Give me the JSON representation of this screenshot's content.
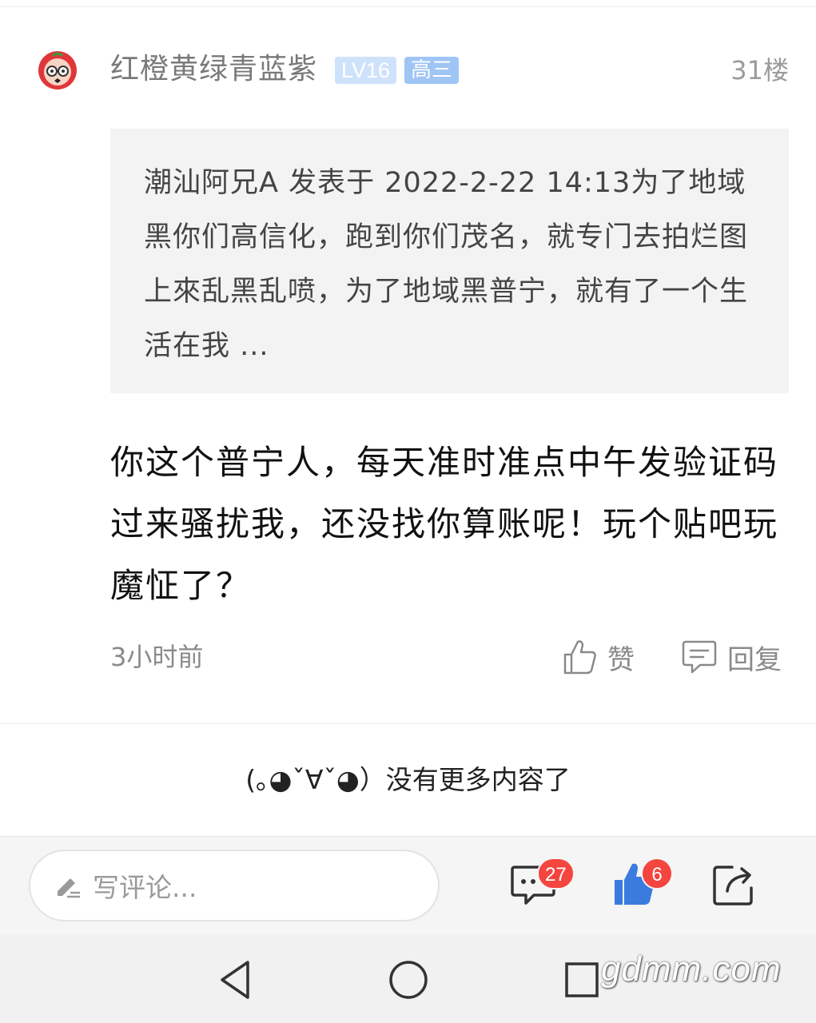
{
  "post": {
    "username": "红橙黄绿青蓝紫",
    "level_badge": "LV16",
    "grade_badge": "高三",
    "floor": "31楼",
    "quote_text": "潮汕阿兄A 发表于 2022-2-22 14:13为了地域黑你们高信化，跑到你们茂名，就专门去拍烂图上來乱黑乱喷，为了地域黑普宁，就有了一个生活在我 ...",
    "body": "你这个普宁人，每天准时准点中午发验证码过来骚扰我，还没找你算账呢！玩个贴吧玩魔怔了？",
    "time": "3小时前",
    "like_label": "赞",
    "reply_label": "回复"
  },
  "end_message": "(｡◕ˇ∀ˇ◕）没有更多内容了",
  "comment_bar": {
    "placeholder": "写评论...",
    "comment_count": "27",
    "like_count": "6"
  },
  "watermark": "gdmm.com",
  "colors": {
    "badge_level": "#cfe2fb",
    "badge_grade": "#9fc5f5",
    "count_badge": "#f4453f",
    "like_active": "#3a7be0"
  },
  "icons": [
    "avatar",
    "thumb-up-icon",
    "reply-icon",
    "pencil-icon",
    "comment-icon",
    "thumb-up-filled-icon",
    "share-icon",
    "back-icon",
    "home-icon",
    "recents-icon"
  ]
}
